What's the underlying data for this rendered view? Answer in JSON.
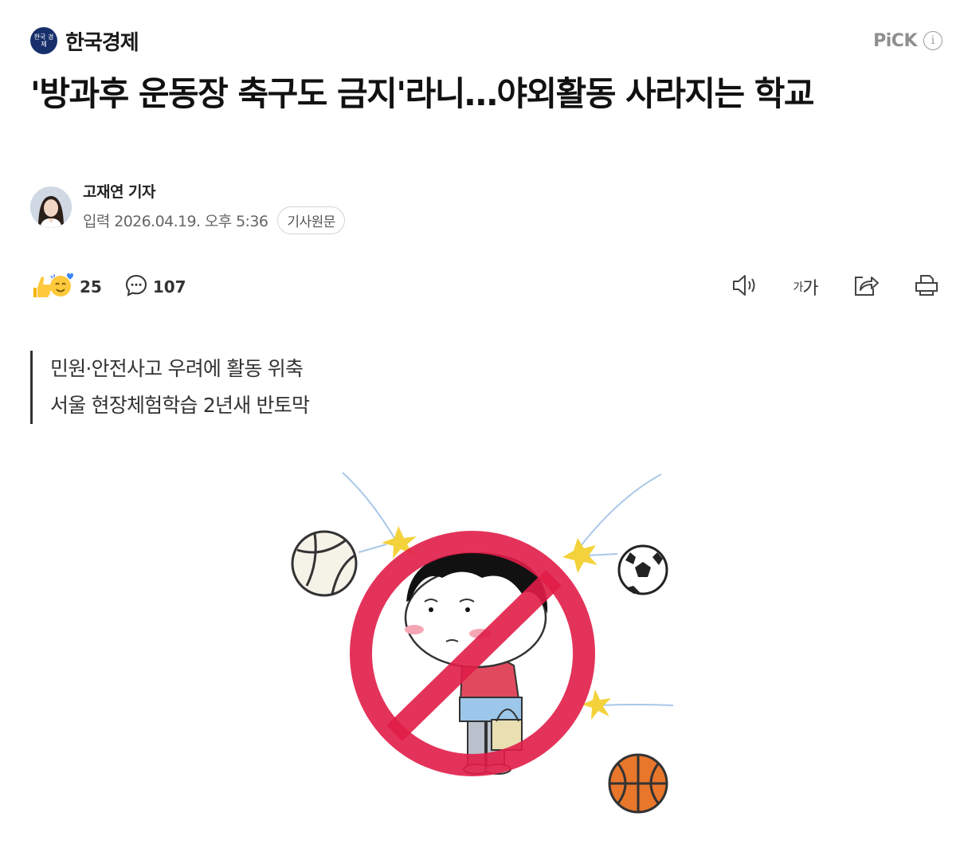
{
  "press": {
    "logo_text": "한국 경제",
    "name": "한국경제"
  },
  "pick": {
    "label": "PiCK",
    "info_glyph": "i"
  },
  "article": {
    "title": "'방과후 운동장 축구도 금지'라니…야외활동 사라지는 학교",
    "reporter": "고재연 기자",
    "date": "입력 2026.04.19. 오후 5:36",
    "original_label": "기사원문"
  },
  "reactions": {
    "likes": "25",
    "comments": "107"
  },
  "toolbar": {
    "font_small": "가",
    "font_large": "가"
  },
  "summary": [
    "민원·안전사고 우려에 활동 위축",
    "서울 현장체험학습 2년새 반토막"
  ],
  "colors": {
    "press_logo": "#17306b",
    "prohibition_red": "#e11d48"
  }
}
